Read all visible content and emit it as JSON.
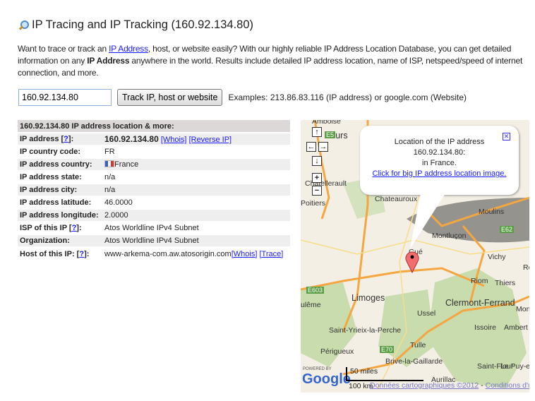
{
  "title": "IP Tracing and IP Tracking (160.92.134.80)",
  "intro": {
    "p1": "Want to trace or track an ",
    "link": "IP Address",
    "p2": ", host, or website easily? With our highly reliable IP Address Location Database, you can get detailed information on any ",
    "bold": "IP Address",
    "p3": " anywhere in the world. Results include detailed IP address location, name of ISP, netspeed/speed of internet connection, and more."
  },
  "search": {
    "value": "160.92.134.80",
    "button": "Track IP, host or website",
    "examples": "Examples: 213.86.83.116 (IP address) or google.com (Website)"
  },
  "table": {
    "header": "160.92.134.80 IP address location & more:",
    "help": "?",
    "rows": [
      {
        "label": "IP address [",
        "value": "160.92.134.80",
        "links": [
          "[Whois]",
          "[Reverse IP]"
        ]
      },
      {
        "label": "IP country code:",
        "value": "FR"
      },
      {
        "label": "IP address country:",
        "value": "France"
      },
      {
        "label": "IP address state:",
        "value": "n/a"
      },
      {
        "label": "IP address city:",
        "value": "n/a"
      },
      {
        "label": "IP address latitude:",
        "value": "46.0000"
      },
      {
        "label": "IP address longitude:",
        "value": "2.0000"
      },
      {
        "label": "ISP of this IP [",
        "value": "Atos Worldline IPv4 Subnet"
      },
      {
        "label": "Organization:",
        "value": "Atos Worldline IPv4 Subnet"
      },
      {
        "label": "Host of this IP: [",
        "value": "www-arkema-com.aw.atosorigin.com",
        "links": [
          "[Whois]",
          "[Trace]"
        ]
      }
    ]
  },
  "map": {
    "bubble": {
      "l1": "Location of the IP address",
      "l2": "160.92.134.80:",
      "l3": "in France.",
      "link": "Click for big IP address location image."
    },
    "labels": [
      "Amboise",
      "Tours",
      "Châtellerault",
      "Poitiers",
      "Chateauroux",
      "Moulins",
      "Montluçon",
      "Gué",
      "Vichy",
      "Riom",
      "Thiers",
      "Limoges",
      "Clermont-Ferrand",
      "Mon",
      "ulême",
      "Ussel",
      "Issoire",
      "Ambert",
      "Saint-Yrieix-la-Perche",
      "Tulle",
      "Périgueux",
      "Brive-la-Gaillarde",
      "Saint-Flour",
      "Le Puy-en-",
      "Aurillac",
      "Ro"
    ],
    "roads": [
      "E5",
      "E62",
      "E603",
      "E70"
    ],
    "scale": {
      "miles": "50 miles",
      "km": "100 km"
    },
    "powered": "POWERED BY",
    "google": "Google",
    "footer": {
      "data": "Données cartographiques ©2012",
      "sep": " - ",
      "terms": "Conditions d'utilisation"
    },
    "colors": {
      "forest": "#c9dcae",
      "road": "#f4a640",
      "land": "#f4efe4",
      "pin": "#f26d6d"
    }
  }
}
